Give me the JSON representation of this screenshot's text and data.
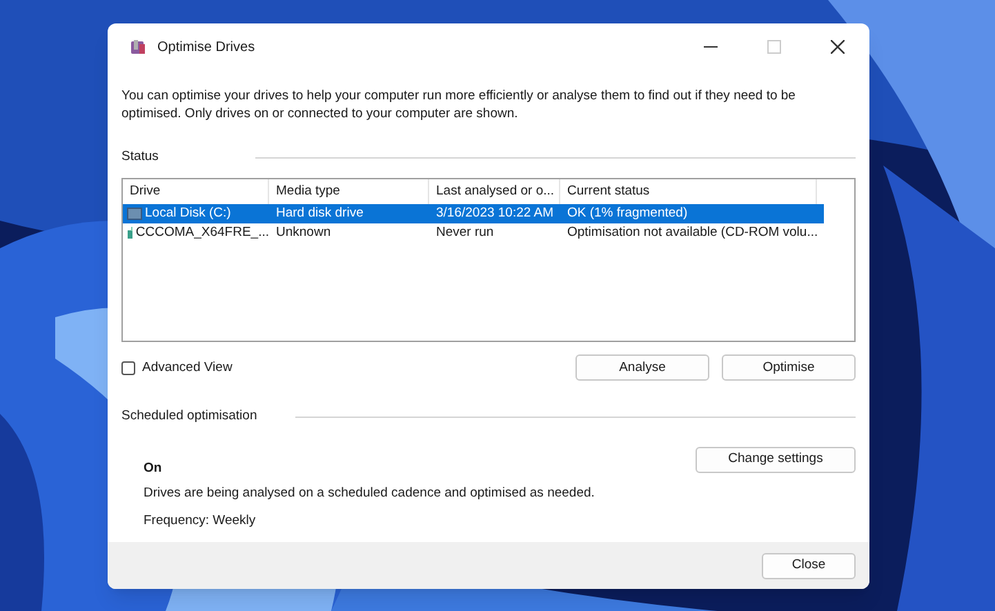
{
  "window": {
    "title": "Optimise Drives"
  },
  "description": "You can optimise your drives to help your computer run more efficiently or analyse them to find out if they need to be optimised. Only drives on or connected to your computer are shown.",
  "status": {
    "heading": "Status",
    "columns": [
      "Drive",
      "Media type",
      "Last analysed or o...",
      "Current status"
    ],
    "rows": [
      {
        "kind": "disk",
        "drive": "Local Disk  (C:)",
        "media_type": "Hard disk drive",
        "last_analysed": "3/16/2023 10:22 AM",
        "current_status": "OK (1% fragmented)",
        "selected": true
      },
      {
        "kind": "disc",
        "drive": "CCCOMA_X64FRE_...",
        "media_type": "Unknown",
        "last_analysed": "Never run",
        "current_status": "Optimisation not available (CD-ROM volu...",
        "selected": false
      }
    ]
  },
  "advanced_view": {
    "label": "Advanced View",
    "checked": false
  },
  "buttons": [
    "Analyse",
    "Optimise"
  ],
  "scheduled": {
    "heading": "Scheduled optimisation",
    "state": "On",
    "text": "Drives are being analysed on a scheduled cadence and optimised as needed.",
    "frequency": "Frequency: Weekly",
    "button": "Change settings"
  },
  "footer": {
    "button": "Close"
  }
}
